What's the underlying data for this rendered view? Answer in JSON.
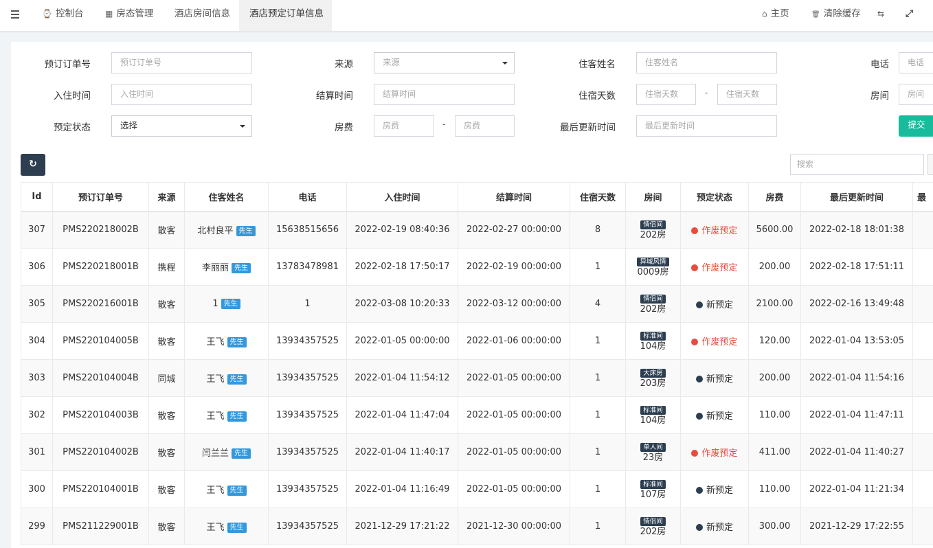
{
  "nav": {
    "tabs": [
      {
        "icon": "⌚",
        "label": "控制台"
      },
      {
        "icon": "▦",
        "label": "房态管理"
      },
      {
        "label": "酒店房间信息"
      },
      {
        "label": "酒店预定订单信息"
      }
    ],
    "home_icon": "⌂",
    "home": "主页",
    "clear_icon": "🗑",
    "clear_cache": "清除缓存",
    "lang_icon": "⇆",
    "fullscreen_icon": "⤢"
  },
  "filters": {
    "order_no": {
      "label": "预订订单号",
      "placeholder": "预订订单号"
    },
    "source": {
      "label": "来源",
      "placeholder": "来源"
    },
    "guest_name": {
      "label": "住客姓名",
      "placeholder": "住客姓名"
    },
    "phone": {
      "label": "电话",
      "placeholder": "电话"
    },
    "checkin": {
      "label": "入住时间",
      "placeholder": "入住时间"
    },
    "checkout": {
      "label": "结算时间",
      "placeholder": "结算时间"
    },
    "nights": {
      "label": "住宿天数",
      "placeholder_from": "住宿天数",
      "placeholder_to": "住宿天数"
    },
    "room": {
      "label": "房间",
      "placeholder": "房间"
    },
    "status": {
      "label": "预定状态",
      "value": "选择"
    },
    "fee": {
      "label": "房费",
      "placeholder_from": "房费",
      "placeholder_to": "房费"
    },
    "updated": {
      "label": "最后更新时间",
      "placeholder": "最后更新时间"
    },
    "dash": "-",
    "submit": "提交"
  },
  "toolbar": {
    "refresh_icon": "↻",
    "search_placeholder": "搜索"
  },
  "table": {
    "columns": [
      "Id",
      "预订订单号",
      "来源",
      "住客姓名",
      "电话",
      "入住时间",
      "结算时间",
      "住宿天数",
      "房间",
      "预定状态",
      "房费",
      "最后更新时间",
      "最"
    ],
    "rows": [
      {
        "id": "307",
        "order": "PMS220218002B",
        "source": "散客",
        "name": "北村良平",
        "title": "先生",
        "phone": "15638515656",
        "checkin": "2022-02-19 08:40:36",
        "checkout": "2022-02-27 00:00:00",
        "nights": "8",
        "room_type": "情侣间",
        "room": "202房",
        "status": "作废预定",
        "status_color": "#e74c3c",
        "fee": "5600.00",
        "updated": "2022-02-18 18:01:38"
      },
      {
        "id": "306",
        "order": "PMS220218001B",
        "source": "携程",
        "name": "李丽丽",
        "title": "先生",
        "phone": "13783478981",
        "checkin": "2022-02-18 17:50:17",
        "checkout": "2022-02-19 00:00:00",
        "nights": "1",
        "room_type": "异域风情",
        "room": "0009房",
        "status": "作废预定",
        "status_color": "#e74c3c",
        "fee": "200.00",
        "updated": "2022-02-18 17:51:11"
      },
      {
        "id": "305",
        "order": "PMS220216001B",
        "source": "散客",
        "name": "1",
        "title": "先生",
        "phone": "1",
        "checkin": "2022-03-08 10:20:33",
        "checkout": "2022-03-12 00:00:00",
        "nights": "4",
        "room_type": "情侣间",
        "room": "202房",
        "status": "新预定",
        "status_color": "#2c3e50",
        "fee": "2100.00",
        "updated": "2022-02-16 13:49:48"
      },
      {
        "id": "304",
        "order": "PMS220104005B",
        "source": "散客",
        "name": "王飞",
        "title": "先生",
        "phone": "13934357525",
        "checkin": "2022-01-05 00:00:00",
        "checkout": "2022-01-06 00:00:00",
        "nights": "1",
        "room_type": "标准间",
        "room": "104房",
        "status": "作废预定",
        "status_color": "#e74c3c",
        "fee": "120.00",
        "updated": "2022-01-04 13:53:05"
      },
      {
        "id": "303",
        "order": "PMS220104004B",
        "source": "同城",
        "name": "王飞",
        "title": "先生",
        "phone": "13934357525",
        "checkin": "2022-01-04 11:54:12",
        "checkout": "2022-01-05 00:00:00",
        "nights": "1",
        "room_type": "大床房",
        "room": "203房",
        "status": "新预定",
        "status_color": "#2c3e50",
        "fee": "200.00",
        "updated": "2022-01-04 11:54:16"
      },
      {
        "id": "302",
        "order": "PMS220104003B",
        "source": "散客",
        "name": "王飞",
        "title": "先生",
        "phone": "13934357525",
        "checkin": "2022-01-04 11:47:04",
        "checkout": "2022-01-05 00:00:00",
        "nights": "1",
        "room_type": "标准间",
        "room": "104房",
        "status": "新预定",
        "status_color": "#2c3e50",
        "fee": "110.00",
        "updated": "2022-01-04 11:47:11"
      },
      {
        "id": "301",
        "order": "PMS220104002B",
        "source": "散客",
        "name": "闫兰兰",
        "title": "先生",
        "phone": "13934357525",
        "checkin": "2022-01-04 11:40:17",
        "checkout": "2022-01-05 00:00:00",
        "nights": "1",
        "room_type": "单人间",
        "room": "23房",
        "status": "作废预定",
        "status_color": "#e74c3c",
        "fee": "411.00",
        "updated": "2022-01-04 11:40:27"
      },
      {
        "id": "300",
        "order": "PMS220104001B",
        "source": "散客",
        "name": "王飞",
        "title": "先生",
        "phone": "13934357525",
        "checkin": "2022-01-04 11:16:49",
        "checkout": "2022-01-05 00:00:00",
        "nights": "1",
        "room_type": "标准间",
        "room": "107房",
        "status": "新预定",
        "status_color": "#2c3e50",
        "fee": "110.00",
        "updated": "2022-01-04 11:21:34"
      },
      {
        "id": "299",
        "order": "PMS211229001B",
        "source": "散客",
        "name": "王飞",
        "title": "先生",
        "phone": "13934357525",
        "checkin": "2021-12-29 17:21:22",
        "checkout": "2021-12-30 00:00:00",
        "nights": "1",
        "room_type": "情侣间",
        "room": "202房",
        "status": "新预定",
        "status_color": "#2c3e50",
        "fee": "300.00",
        "updated": "2021-12-29 17:22:55"
      }
    ]
  }
}
